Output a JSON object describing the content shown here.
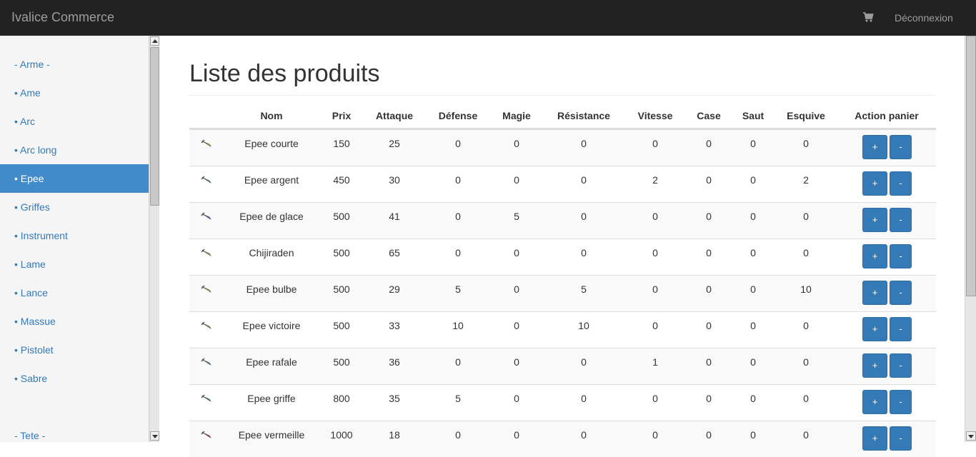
{
  "navbar": {
    "brand": "Ivalice Commerce",
    "cart_icon": "cart-icon",
    "logout": "Déconnexion"
  },
  "sidebar": {
    "items": [
      {
        "label": "- Arme -",
        "active": false
      },
      {
        "label": "• Ame",
        "active": false
      },
      {
        "label": "• Arc",
        "active": false
      },
      {
        "label": "• Arc long",
        "active": false
      },
      {
        "label": "• Epee",
        "active": true
      },
      {
        "label": "• Griffes",
        "active": false
      },
      {
        "label": "• Instrument",
        "active": false
      },
      {
        "label": "• Lame",
        "active": false
      },
      {
        "label": "• Lance",
        "active": false
      },
      {
        "label": "• Massue",
        "active": false
      },
      {
        "label": "• Pistolet",
        "active": false
      },
      {
        "label": "• Sabre",
        "active": false
      },
      {
        "label": "",
        "active": false
      },
      {
        "label": "- Tete -",
        "active": false
      }
    ]
  },
  "main": {
    "title": "Liste des produits",
    "columns": [
      "",
      "Nom",
      "Prix",
      "Attaque",
      "Défense",
      "Magie",
      "Résistance",
      "Vitesse",
      "Case",
      "Saut",
      "Esquive",
      "Action panier"
    ],
    "plus_label": "+",
    "minus_label": "-",
    "rows": [
      {
        "icon": "sword-icon",
        "color": "#d8b020",
        "cells": [
          "Epee courte",
          "150",
          "25",
          "0",
          "0",
          "0",
          "0",
          "0",
          "0",
          "0"
        ]
      },
      {
        "icon": "sword-icon",
        "color": "#5aa090",
        "cells": [
          "Epee argent",
          "450",
          "30",
          "0",
          "0",
          "0",
          "2",
          "0",
          "0",
          "2"
        ]
      },
      {
        "icon": "sword-icon",
        "color": "#3a70c8",
        "cells": [
          "Epee de glace",
          "500",
          "41",
          "0",
          "5",
          "0",
          "0",
          "0",
          "0",
          "0"
        ]
      },
      {
        "icon": "sword-icon",
        "color": "#c8a030",
        "cells": [
          "Chijiraden",
          "500",
          "65",
          "0",
          "0",
          "0",
          "0",
          "0",
          "0",
          "0"
        ]
      },
      {
        "icon": "sword-icon",
        "color": "#d0c020",
        "cells": [
          "Epee bulbe",
          "500",
          "29",
          "5",
          "0",
          "5",
          "0",
          "0",
          "0",
          "10"
        ]
      },
      {
        "icon": "sword-icon",
        "color": "#c09828",
        "cells": [
          "Epee victoire",
          "500",
          "33",
          "10",
          "0",
          "10",
          "0",
          "0",
          "0",
          "0"
        ]
      },
      {
        "icon": "sword-icon",
        "color": "#4088c0",
        "cells": [
          "Epee rafale",
          "500",
          "36",
          "0",
          "0",
          "0",
          "1",
          "0",
          "0",
          "0"
        ]
      },
      {
        "icon": "sword-icon",
        "color": "#3a8878",
        "cells": [
          "Epee griffe",
          "800",
          "35",
          "5",
          "0",
          "0",
          "0",
          "0",
          "0",
          "0"
        ]
      },
      {
        "icon": "sword-icon",
        "color": "#c83040",
        "cells": [
          "Epee vermeille",
          "1000",
          "18",
          "0",
          "0",
          "0",
          "0",
          "0",
          "0",
          "0"
        ]
      }
    ]
  }
}
